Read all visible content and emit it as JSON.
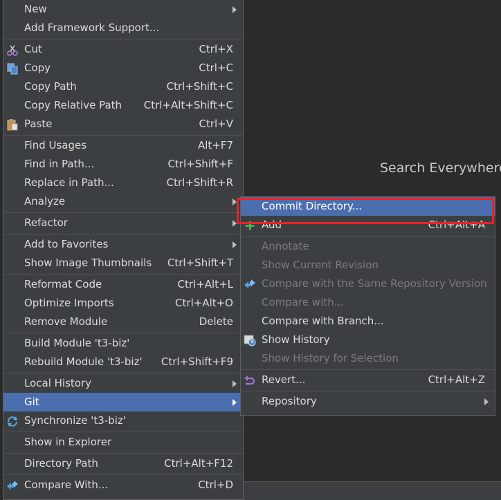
{
  "background_hint": {
    "search_everywhere": "Search Everywhere"
  },
  "main_menu": {
    "items": [
      {
        "label": "New",
        "submenu": true
      },
      {
        "label": "Add Framework Support..."
      },
      {
        "sep": true
      },
      {
        "label": "Cut",
        "shortcut": "Ctrl+X",
        "icon": "scissors-icon"
      },
      {
        "label": "Copy",
        "shortcut": "Ctrl+C",
        "icon": "copy-icon"
      },
      {
        "label": "Copy Path",
        "shortcut": "Ctrl+Shift+C"
      },
      {
        "label": "Copy Relative Path",
        "shortcut": "Ctrl+Alt+Shift+C"
      },
      {
        "label": "Paste",
        "shortcut": "Ctrl+V",
        "icon": "paste-icon"
      },
      {
        "sep": true
      },
      {
        "label": "Find Usages",
        "shortcut": "Alt+F7"
      },
      {
        "label": "Find in Path...",
        "shortcut": "Ctrl+Shift+F"
      },
      {
        "label": "Replace in Path...",
        "shortcut": "Ctrl+Shift+R"
      },
      {
        "label": "Analyze",
        "submenu": true
      },
      {
        "sep": true
      },
      {
        "label": "Refactor",
        "submenu": true
      },
      {
        "sep": true
      },
      {
        "label": "Add to Favorites",
        "submenu": true
      },
      {
        "label": "Show Image Thumbnails",
        "shortcut": "Ctrl+Shift+T"
      },
      {
        "sep": true
      },
      {
        "label": "Reformat Code",
        "shortcut": "Ctrl+Alt+L"
      },
      {
        "label": "Optimize Imports",
        "shortcut": "Ctrl+Alt+O"
      },
      {
        "label": "Remove Module",
        "shortcut": "Delete"
      },
      {
        "sep": true
      },
      {
        "label": "Build Module 't3-biz'"
      },
      {
        "label": "Rebuild Module 't3-biz'",
        "shortcut": "Ctrl+Shift+F9"
      },
      {
        "sep": true
      },
      {
        "label": "Local History",
        "submenu": true
      },
      {
        "label": "Git",
        "submenu": true,
        "selected": true
      },
      {
        "label": "Synchronize 't3-biz'",
        "icon": "sync-icon"
      },
      {
        "sep": true
      },
      {
        "label": "Show in Explorer"
      },
      {
        "sep": true
      },
      {
        "label": "Directory Path",
        "shortcut": "Ctrl+Alt+F12"
      },
      {
        "sep": true
      },
      {
        "label": "Compare With...",
        "shortcut": "Ctrl+D",
        "icon": "compare-icon"
      }
    ]
  },
  "git_menu": {
    "items": [
      {
        "label": "Commit Directory...",
        "selected": true
      },
      {
        "label": "Add",
        "shortcut": "Ctrl+Alt+A",
        "icon": "plus-icon"
      },
      {
        "sep": true
      },
      {
        "label": "Annotate",
        "disabled": true
      },
      {
        "label": "Show Current Revision",
        "disabled": true
      },
      {
        "label": "Compare with the Same Repository Version",
        "disabled": true,
        "icon": "compare-icon"
      },
      {
        "label": "Compare with...",
        "disabled": true
      },
      {
        "label": "Compare with Branch..."
      },
      {
        "label": "Show History",
        "icon": "history-icon"
      },
      {
        "label": "Show History for Selection",
        "disabled": true
      },
      {
        "sep": true
      },
      {
        "label": "Revert...",
        "shortcut": "Ctrl+Alt+Z",
        "icon": "revert-icon"
      },
      {
        "sep": true
      },
      {
        "label": "Repository",
        "submenu": true
      }
    ]
  }
}
